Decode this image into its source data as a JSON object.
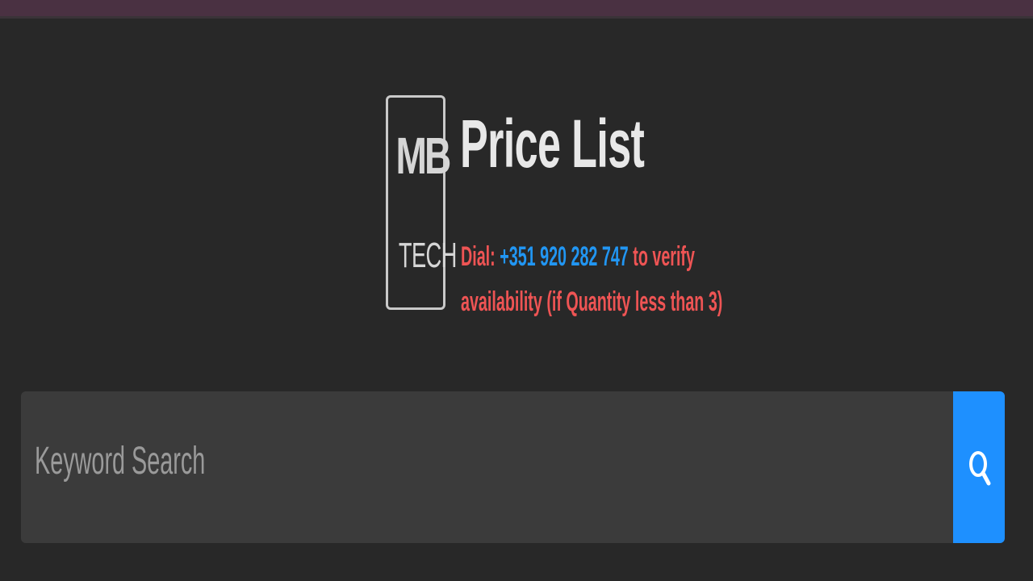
{
  "logo": {
    "line1": "MB",
    "line2": "TECH"
  },
  "header": {
    "title": "Price List"
  },
  "notice": {
    "prefix": "Dial: ",
    "phone": "+351 920 282 747",
    "suffix_line1": " to verify",
    "line2": "availability (if Quantity less than 3)"
  },
  "search": {
    "placeholder": "Keyword Search",
    "value": "",
    "button_icon": "search-icon"
  },
  "colors": {
    "background": "#282828",
    "top_bar": "#4a3142",
    "accent": "#1e90ff",
    "notice_red": "#ee5454",
    "phone_blue": "#2196f3"
  }
}
